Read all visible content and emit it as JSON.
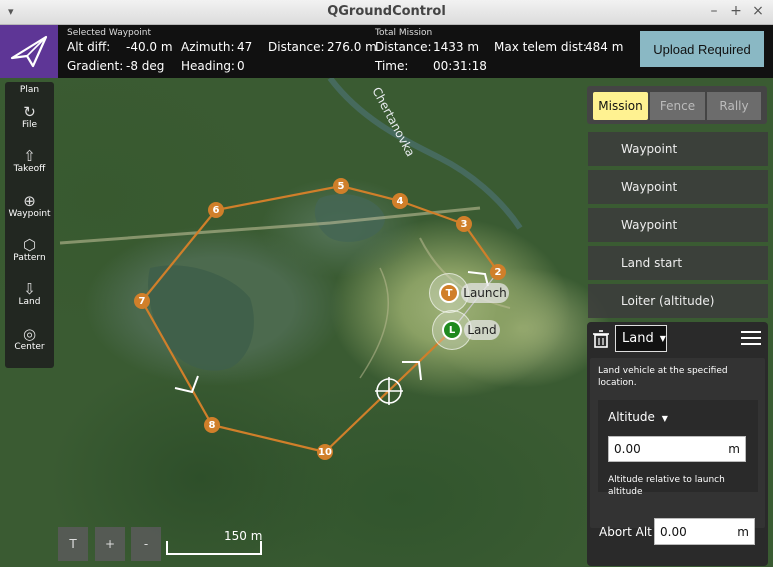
{
  "window": {
    "title": "QGroundControl"
  },
  "toolbar": {
    "selected_header": "Selected Waypoint",
    "alt_diff_label": "Alt diff:",
    "alt_diff_value": "-40.0 m",
    "gradient_label": "Gradient:",
    "gradient_value": "-8 deg",
    "azimuth_label": "Azimuth:",
    "azimuth_value": "47",
    "heading_label": "Heading:",
    "heading_value": "0",
    "distance_label": "Distance:",
    "distance_value": "276.0 m",
    "total_header": "Total Mission",
    "total_distance_label": "Distance:",
    "total_distance_value": "1433 m",
    "time_label": "Time:",
    "time_value": "00:31:18",
    "max_telem_label": "Max telem dist:",
    "max_telem_value": "484 m",
    "upload_label": "Upload Required"
  },
  "tools": [
    {
      "label": "Plan",
      "icon": "plan"
    },
    {
      "label": "File",
      "icon": "file-icon"
    },
    {
      "label": "Takeoff",
      "icon": "takeoff-icon"
    },
    {
      "label": "Waypoint",
      "icon": "waypoint-icon"
    },
    {
      "label": "Pattern",
      "icon": "pattern-icon"
    },
    {
      "label": "Land",
      "icon": "land-icon"
    },
    {
      "label": "Center",
      "icon": "center-icon"
    }
  ],
  "map": {
    "area_label": "Chertanovka",
    "waypoints": [
      "2",
      "3",
      "4",
      "5",
      "6",
      "7",
      "8",
      "10"
    ],
    "launch_label": "Launch",
    "land_label": "Land",
    "launch_badge": "T",
    "land_badge": "L",
    "scale_label": "150 m",
    "zoom_buttons": [
      "T",
      "+",
      "-"
    ]
  },
  "panel": {
    "tabs": [
      "Mission",
      "Fence",
      "Rally"
    ],
    "items": [
      "Waypoint",
      "Waypoint",
      "Waypoint",
      "Land start",
      "Loiter (altitude)"
    ],
    "editor": {
      "command": "Land",
      "description": "Land vehicle at the specified location.",
      "altitude_label": "Altitude",
      "altitude_value": "0.00",
      "altitude_unit": "m",
      "altitude_help": "Altitude relative to launch altitude",
      "abort_label": "Abort Alt",
      "abort_value": "0.00",
      "abort_unit": "m"
    }
  }
}
